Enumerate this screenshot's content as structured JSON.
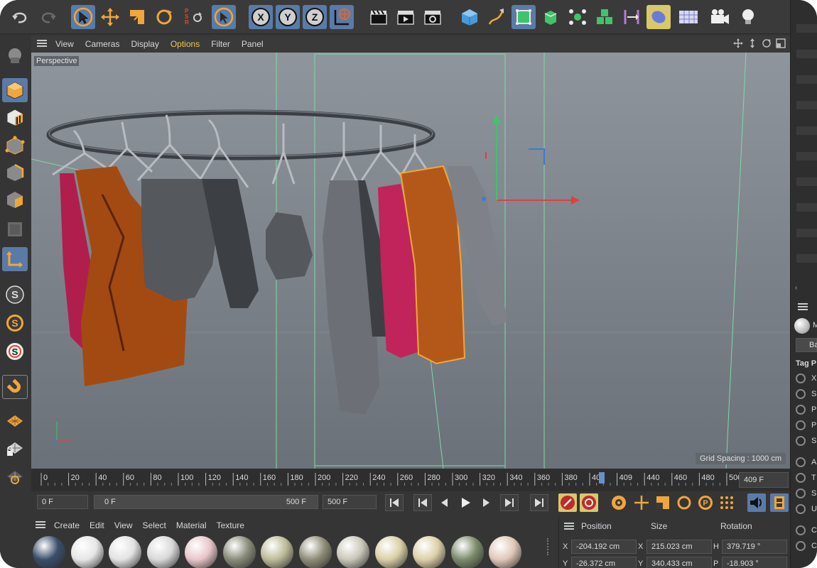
{
  "viewport": {
    "menu": [
      {
        "label": "View",
        "active": false
      },
      {
        "label": "Cameras",
        "active": false
      },
      {
        "label": "Display",
        "active": false
      },
      {
        "label": "Options",
        "active": true
      },
      {
        "label": "Filter",
        "active": false
      },
      {
        "label": "Panel",
        "active": false
      }
    ],
    "camera_label": "Perspective",
    "grid_spacing": "Grid Spacing : 1000 cm"
  },
  "toolbar": {
    "psr_label": "P S R",
    "axis_x": "X",
    "axis_y": "Y",
    "axis_z": "Z"
  },
  "left_toolbar": {
    "s_label": "S"
  },
  "timeline": {
    "ticks": [
      "0",
      "20",
      "40",
      "60",
      "80",
      "100",
      "120",
      "140",
      "160",
      "180",
      "200",
      "220",
      "240",
      "260",
      "280",
      "300",
      "320",
      "340",
      "360",
      "380",
      "400",
      "409",
      "440",
      "460",
      "480",
      "500"
    ],
    "current_frame": "409 F",
    "playhead_value": 409,
    "max_frame": 500
  },
  "transport": {
    "start": "0 F",
    "range_start": "0 F",
    "range_end": "500 F",
    "end": "500 F"
  },
  "material_manager": {
    "menu": [
      "Create",
      "Edit",
      "View",
      "Select",
      "Material",
      "Texture"
    ],
    "swatch_colors": [
      "#3a4f6a",
      "#e6e6e6",
      "#e2e2e2",
      "#d9d9d9",
      "#e8c6c8",
      "#8a8c7a",
      "#bdbb98",
      "#8f8d78",
      "#c9c7b8",
      "#d9cfa6",
      "#dcd0a8",
      "#7b8b6a",
      "#e0c8b8"
    ]
  },
  "coordinates": {
    "headers": [
      "Position",
      "Size",
      "Rotation"
    ],
    "rows": [
      {
        "axis": "X",
        "position": "-204.192 cm",
        "size_axis": "X",
        "size": "215.023 cm",
        "rot_axis": "H",
        "rotation": "379.719 °"
      },
      {
        "axis": "Y",
        "position": "-26.372 cm",
        "size_axis": "Y",
        "size": "340.433 cm",
        "rot_axis": "P",
        "rotation": "-18.903 °"
      }
    ]
  },
  "attributes": {
    "tag_label": "Tag P",
    "mode_label": "Ba",
    "material_label": "M",
    "radio_letters": [
      "X",
      "S",
      "P",
      "P",
      "S",
      "A",
      "T",
      "S",
      "U",
      "C",
      "C"
    ]
  },
  "colors": {
    "accent": "#5a7ba8",
    "menu_active": "#f0c94b",
    "playhead": "#6a8fc9"
  }
}
